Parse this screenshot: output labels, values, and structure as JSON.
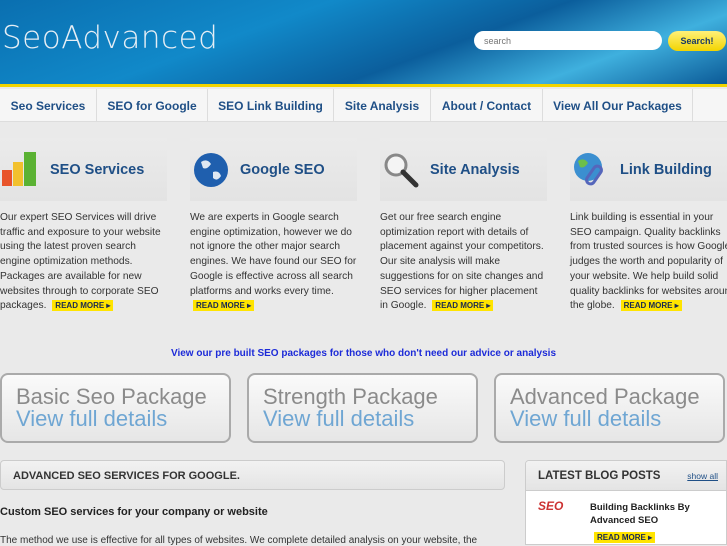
{
  "header": {
    "logo": "SeoAdvanced",
    "search_placeholder": "search",
    "search_button": "Search!"
  },
  "nav": [
    "Seo Services",
    "SEO for Google",
    "SEO Link Building",
    "Site Analysis",
    "About / Contact",
    "View All Our Packages"
  ],
  "features": [
    {
      "title": "SEO Services",
      "icon": "bar-chart-icon",
      "text": "Our expert SEO Services will drive traffic and exposure to your website using the latest proven search engine optimization methods. Packages are available for new websites through to corporate SEO packages.",
      "more": "READ MORE ▸"
    },
    {
      "title": "Google SEO",
      "icon": "globe-icon",
      "text": "We are experts in Google search engine optimization, however we do not ignore the other major search engines. We have found our SEO for Google is effective across all search platforms and works every time.",
      "more": "READ MORE ▸"
    },
    {
      "title": "Site Analysis",
      "icon": "magnifier-icon",
      "text": "Get our free search engine optimization report with details of placement against your competitors. Our site analysis will make suggestions for on site changes and SEO services for higher placement in Google.",
      "more": "READ MORE ▸"
    },
    {
      "title": "Link Building",
      "icon": "globe-link-icon",
      "text": "Link building is essential in your SEO campaign. Quality backlinks from trusted sources is how Google judges the worth and popularity of your website. We help build solid quality backlinks for websites around the globe.",
      "more": "READ MORE ▸"
    }
  ],
  "tagline": "View our pre built SEO packages for those who don't need our advice or analysis",
  "packages": [
    {
      "title": "Basic Seo Package",
      "link": "View full details"
    },
    {
      "title": "Strength Package",
      "link": "View full details"
    },
    {
      "title": "Advanced Package",
      "link": "View full details"
    }
  ],
  "main": {
    "heading": "ADVANCED SEO SERVICES FOR GOOGLE.",
    "subheading": "Custom SEO services for your company or website",
    "paragraph": "The method we use is effective for all types of websites. We complete detailed analysis on your website, the"
  },
  "blog": {
    "heading": "LATEST BLOG POSTS",
    "show_all": "show all",
    "post_image_text": "SEO",
    "post_title": "Building Backlinks By Advanced SEO",
    "post_more": "READ MORE ▸"
  }
}
